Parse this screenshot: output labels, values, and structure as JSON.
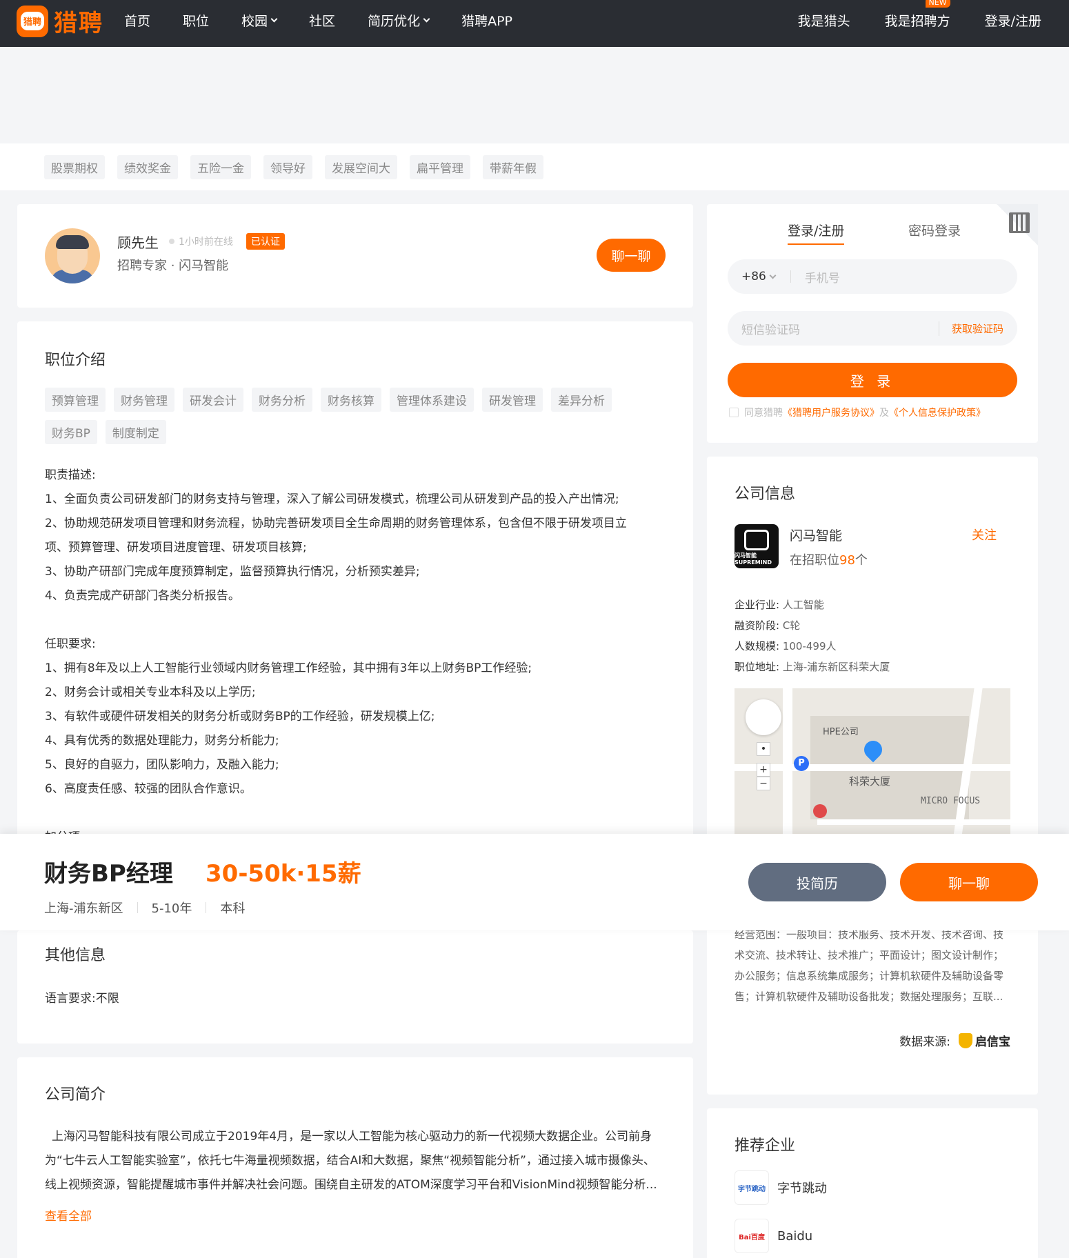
{
  "brand": {
    "logo_badge": "猎聘",
    "name": "猎聘",
    "accent": "#ff6a00",
    "topbar_bg": "#2a2d33"
  },
  "nav": {
    "items": [
      {
        "label": "首页"
      },
      {
        "label": "职位"
      },
      {
        "label": "校园"
      },
      {
        "label": "社区"
      },
      {
        "label": "简历优化"
      },
      {
        "label": "猎聘APP"
      }
    ],
    "right": [
      {
        "label": "我是猎头"
      },
      {
        "label": "我是招聘方",
        "badge": "NEW"
      },
      {
        "label": "登录/注册"
      }
    ]
  },
  "benefits": [
    "股票期权",
    "绩效奖金",
    "五险一金",
    "领导好",
    "发展空间大",
    "扁平管理",
    "带薪年假"
  ],
  "recruiter": {
    "name": "顾先生",
    "online": "1小时前在线",
    "verified": "已认证",
    "title": "招聘专家 · 闪马智能",
    "chat": "聊一聊"
  },
  "job_desc": {
    "title": "职位介绍",
    "tags": [
      "预算管理",
      "财务管理",
      "研发会计",
      "财务分析",
      "财务核算",
      "管理体系建设",
      "研发管理",
      "差异分析",
      "财务BP",
      "制度制定"
    ],
    "text": "职责描述:\n1、全面负责公司研发部门的财务支持与管理，深入了解公司研发模式，梳理公司从研发到产品的投入产出情况;\n2、协助规范研发项目管理和财务流程，协助完善研发项目全生命周期的财务管理体系，包含但不限于研发项目立\n项、预算管理、研发项目进度管理、研发项目核算;\n3、协助产研部门完成年度预算制定，监督预算执行情况，分析预实差异;\n4、负责完成产研部门各类分析报告。\n\n任职要求:\n1、拥有8年及以上人工智能行业领域内财务管理工作经验，其中拥有3年以上财务BP工作经验;\n2、财务会计或相关专业本科及以上学历;\n3、有软件或硬件研发相关的财务分析或财务BP的工作经验，研发规模上亿;\n4、具有优秀的数据处理能力，财务分析能力;\n5、良好的自驱力，团队影响力，及融入能力;\n6、高度责任感、较强的团队合作意识。\n\n加分项:"
  },
  "job": {
    "title": "财务BP经理",
    "salary": "30-50k·15薪",
    "location": "上海-浦东新区",
    "experience": "5-10年",
    "education": "本科",
    "resume_btn": "投简历",
    "chat_btn": "聊一聊"
  },
  "other": {
    "title": "其他信息",
    "language_label": "语言要求:",
    "language_value": "不限"
  },
  "intro": {
    "title": "公司简介",
    "text": "上海闪马智能科技有限公司成立于2019年4月，是一家以人工智能为核心驱动力的新一代视频大数据企业。公司前身为“七牛云人工智能实验室”，依托七牛海量视频数据，结合AI和大数据，聚焦“视频智能分析”，通过接入城市摄像头、线上视频资源，智能提醒城市事件并解决社会问题。围绕自主研发的ATOM深度学习平台和VisionMind视频智能分析...",
    "more": "查看全部"
  },
  "login": {
    "tab_sms": "登录/注册",
    "tab_pwd": "密码登录",
    "country_code": "+86",
    "phone_placeholder": "手机号",
    "code_placeholder": "短信验证码",
    "get_code": "获取验证码",
    "submit": "登 录",
    "agree_prefix": "同意猎聘",
    "agree_link1": "《猎聘用户服务协议》",
    "agree_mid": "及",
    "agree_link2": "《个人信息保护政策》"
  },
  "company": {
    "title": "公司信息",
    "name": "闪马智能",
    "follow": "关注",
    "jobs_prefix": "在招职位",
    "jobs_count": "98",
    "jobs_suffix": "个",
    "logo_text": "闪马智能 SUPREMIND",
    "info": [
      {
        "k": "企业行业:",
        "v": "人工智能"
      },
      {
        "k": "融资阶段:",
        "v": "C轮"
      },
      {
        "k": "人数规模:",
        "v": "100-499人"
      },
      {
        "k": "职位地址:",
        "v": "上海-浦东新区科荣大厦"
      }
    ],
    "map": {
      "poi1": "HPE公司",
      "poi2": "科荣大厦",
      "poi3": "MICRO FOCUS"
    },
    "scope": "经营范围：一般项目：技术服务、技术开发、技术咨询、技术交流、技术转让、技术推广；平面设计；图文设计制作；办公服务；信息系统集成服务；计算机软硬件及辅助设备零售；计算机软硬件及辅助设备批发；数据处理服务；互联...",
    "source_label": "数据来源:",
    "source_name": "启信宝"
  },
  "recommend": {
    "title": "推荐企业",
    "items": [
      {
        "name": "字节跳动",
        "logo": "字节跳动"
      },
      {
        "name": "Baidu",
        "logo": "Bai百度"
      }
    ]
  }
}
